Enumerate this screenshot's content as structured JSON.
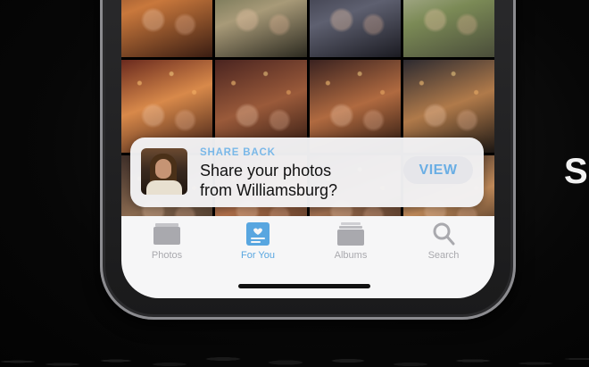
{
  "notification": {
    "eyebrow": "SHARE BACK",
    "message": "Share your photos from Williamsburg?",
    "action_label": "VIEW"
  },
  "tab_bar": {
    "tabs": [
      {
        "label": "Photos",
        "icon": "photos-stack-icon",
        "active": false
      },
      {
        "label": "For You",
        "icon": "for-you-icon",
        "active": true
      },
      {
        "label": "Albums",
        "icon": "albums-icon",
        "active": false
      },
      {
        "label": "Search",
        "icon": "search-icon",
        "active": false
      }
    ]
  },
  "stage": {
    "side_text": "S"
  },
  "colors": {
    "accent": "#58a6e0",
    "inactive": "#a9a9ae",
    "eyebrow": "#7ab8e8"
  }
}
